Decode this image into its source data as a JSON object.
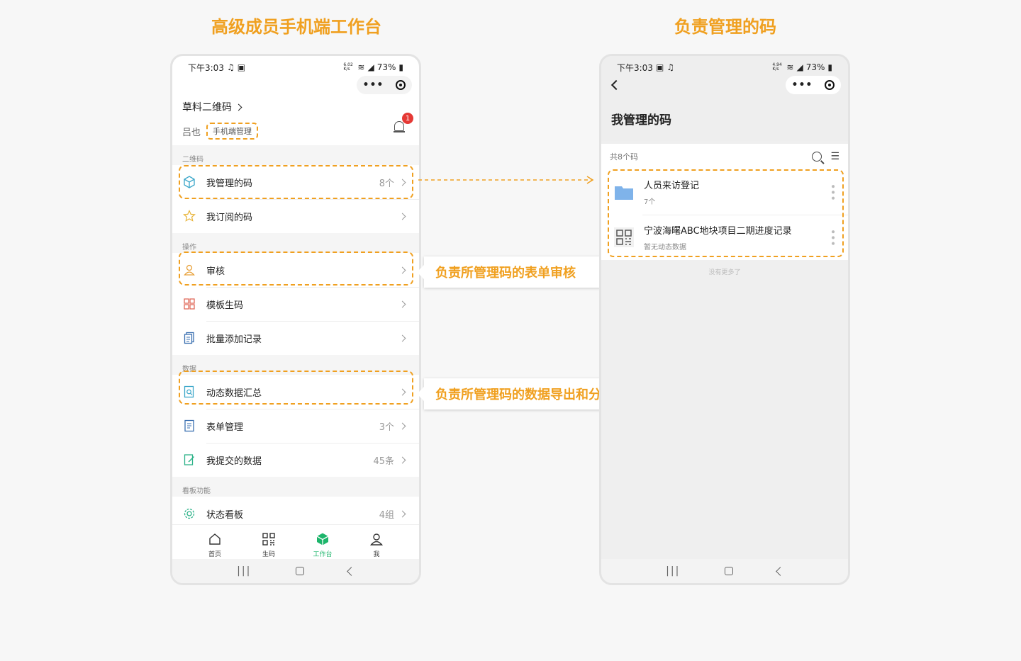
{
  "headings": {
    "left": "高级成员手机端工作台",
    "right": "负责管理的码"
  },
  "left_phone": {
    "status": {
      "time": "下午3:03",
      "speed": "6.02 K/s",
      "battery": "73%"
    },
    "workspace": "草料二维码",
    "user_name": "吕也",
    "role_tag": "手机端管理",
    "badge_count": "1",
    "sections": [
      {
        "title": "二维码",
        "items": [
          {
            "label": "我管理的码",
            "count": "8个"
          },
          {
            "label": "我订阅的码",
            "count": ""
          }
        ]
      },
      {
        "title": "操作",
        "items": [
          {
            "label": "审核",
            "count": ""
          },
          {
            "label": "模板生码",
            "count": ""
          },
          {
            "label": "批量添加记录",
            "count": ""
          }
        ]
      },
      {
        "title": "数据",
        "items": [
          {
            "label": "动态数据汇总",
            "count": ""
          },
          {
            "label": "表单管理",
            "count": "3个"
          },
          {
            "label": "我提交的数据",
            "count": "45条"
          }
        ]
      },
      {
        "title": "看板功能",
        "items": [
          {
            "label": "状态看板",
            "count": "4组"
          }
        ]
      }
    ],
    "tabs": [
      {
        "label": "首页",
        "icon": "home-icon"
      },
      {
        "label": "生码",
        "icon": "qr-grid-icon"
      },
      {
        "label": "工作台",
        "icon": "cube-icon"
      },
      {
        "label": "我",
        "icon": "user-icon"
      }
    ],
    "active_tab": "工作台"
  },
  "right_phone": {
    "status": {
      "time": "下午3:03",
      "speed": "4.94 K/s",
      "battery": "73%"
    },
    "page_title": "我管理的码",
    "total": "共8个码",
    "codes": [
      {
        "name": "人员来访登记",
        "sub": "7个",
        "icon": "folder-icon"
      },
      {
        "name": "宁波海曙ABC地块项目二期进度记录",
        "sub": "暂无动态数据",
        "icon": "qr-code-icon"
      }
    ],
    "no_more": "没有更多了"
  },
  "callouts": {
    "review": "负责所管理码的表单审核",
    "data": "负责所管理码的数据导出和分析"
  },
  "colors": {
    "accent": "#f0a020",
    "active_tab": "#1db56b",
    "badge": "#e53935",
    "folder": "#7fb3ea"
  }
}
